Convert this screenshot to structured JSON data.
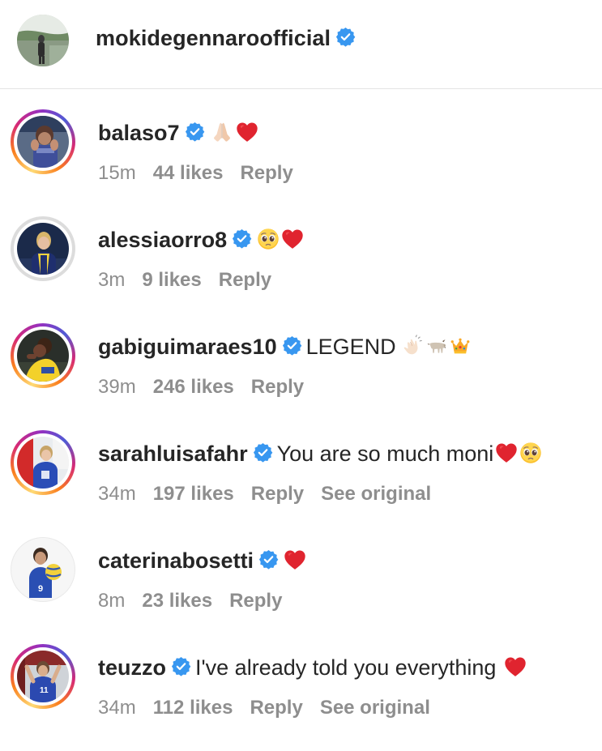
{
  "post": {
    "author": "mokidegennaroofficial"
  },
  "comments": [
    {
      "username": "balaso7",
      "text": "",
      "emojis": [
        "folded-hands",
        "red-heart"
      ],
      "time": "15m",
      "likes": "44 likes",
      "reply": "Reply",
      "see_original": ""
    },
    {
      "username": "alessiaorro8",
      "text": "",
      "emojis": [
        "pleading-face",
        "red-heart"
      ],
      "time": "3m",
      "likes": "9 likes",
      "reply": "Reply",
      "see_original": ""
    },
    {
      "username": "gabiguimaraes10",
      "text": "LEGEND",
      "emojis": [
        "clapping-hands",
        "goat",
        "crown"
      ],
      "time": "39m",
      "likes": "246 likes",
      "reply": "Reply",
      "see_original": ""
    },
    {
      "username": "sarahluisafahr",
      "text": "You are so much moni",
      "emojis": [
        "red-heart",
        "pleading-face"
      ],
      "time": "34m",
      "likes": "197 likes",
      "reply": "Reply",
      "see_original": "See original"
    },
    {
      "username": "caterinabosetti",
      "text": "",
      "emojis": [
        "red-heart"
      ],
      "time": "8m",
      "likes": "23 likes",
      "reply": "Reply",
      "see_original": ""
    },
    {
      "username": "teuzzo",
      "text": "I've already told you everything",
      "emojis": [
        "red-heart"
      ],
      "time": "34m",
      "likes": "112 likes",
      "reply": "Reply",
      "see_original": "See original"
    }
  ],
  "colors": {
    "verified_blue": "#3897f0",
    "meta_gray": "#8e8e8e",
    "text_dark": "#262626",
    "heart_red": "#e0242f"
  }
}
